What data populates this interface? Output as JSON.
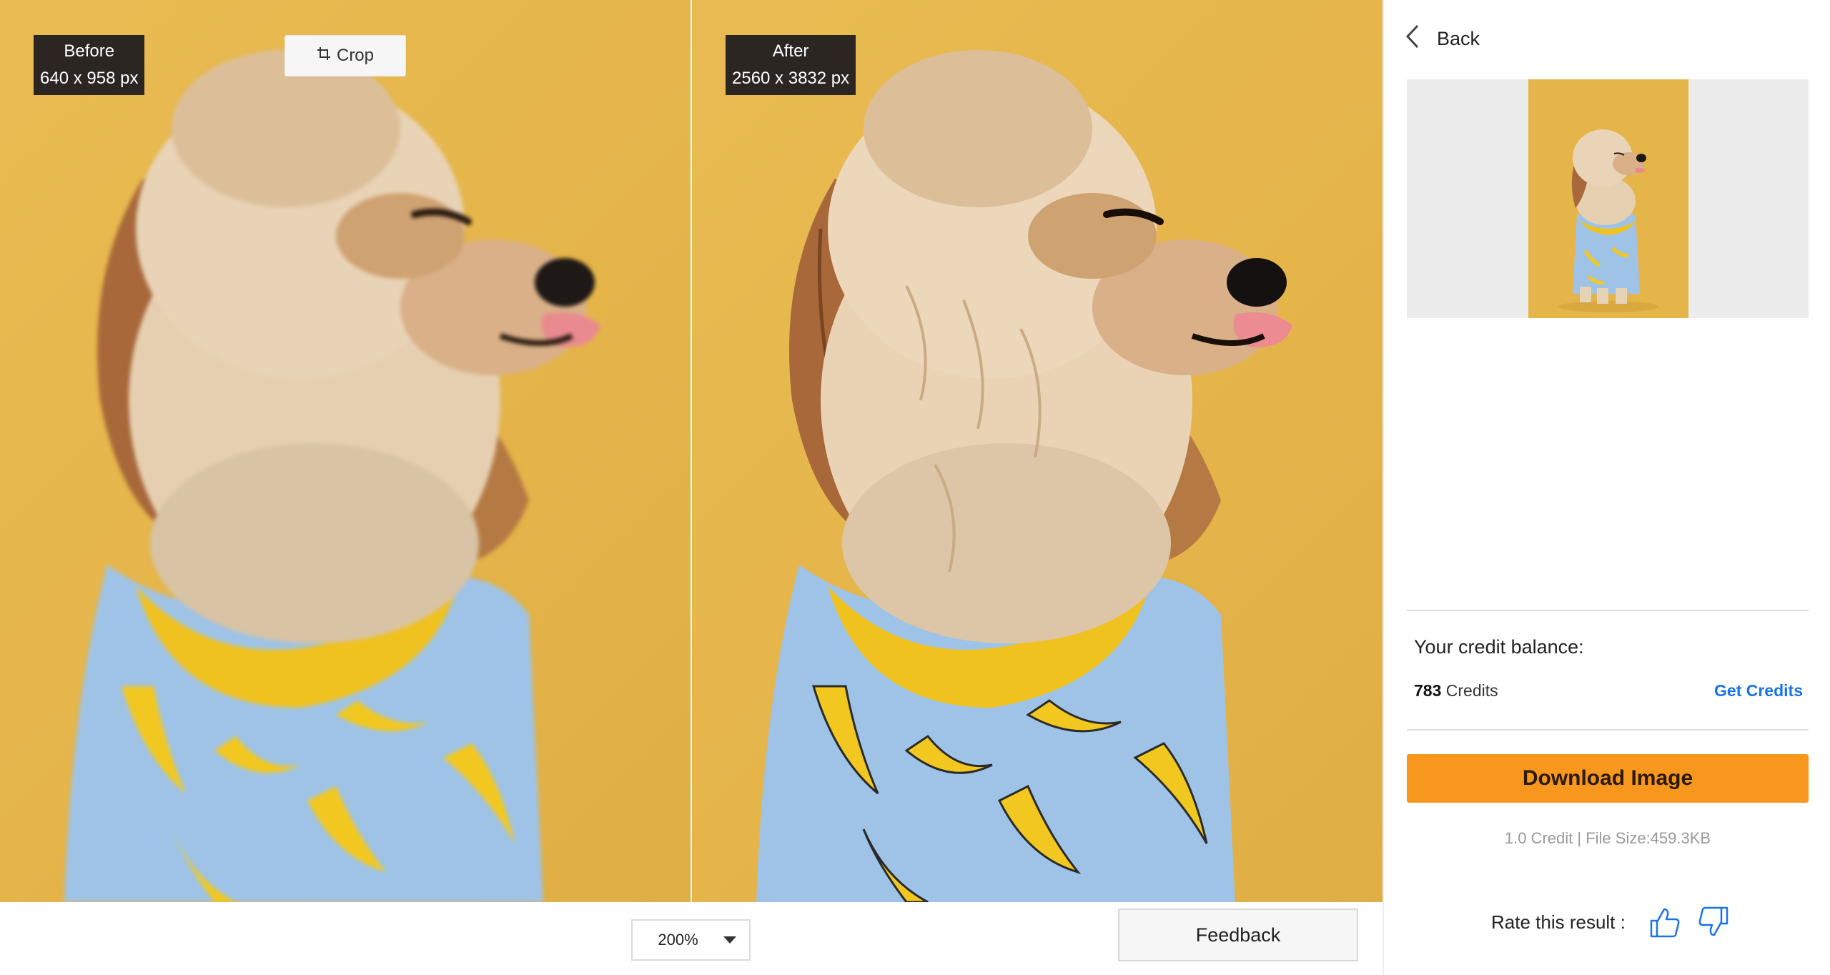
{
  "viewer": {
    "before": {
      "label": "Before",
      "size": "640 x 958 px"
    },
    "after": {
      "label": "After",
      "size": "2560 x 3832 px"
    },
    "crop_label": "Crop",
    "zoom": {
      "value": "200%"
    },
    "feedback_label": "Feedback"
  },
  "sidebar": {
    "back_label": "Back",
    "credit_title": "Your credit balance:",
    "credit_amount": "783",
    "credit_unit": "Credits",
    "get_credits_label": "Get Credits",
    "download_label": "Download Image",
    "file_info": "1.0 Credit | File Size:459.3KB",
    "rate_label": "Rate this result :"
  },
  "colors": {
    "accent_orange": "#f7971e",
    "link_blue": "#1a73e8",
    "background_yellow": "#e5b54a",
    "tag_dark": "#2c2623"
  },
  "icons": [
    "crop-icon",
    "dropdown-caret-icon",
    "chevron-left-icon",
    "thumbs-up-icon",
    "thumbs-down-icon"
  ]
}
